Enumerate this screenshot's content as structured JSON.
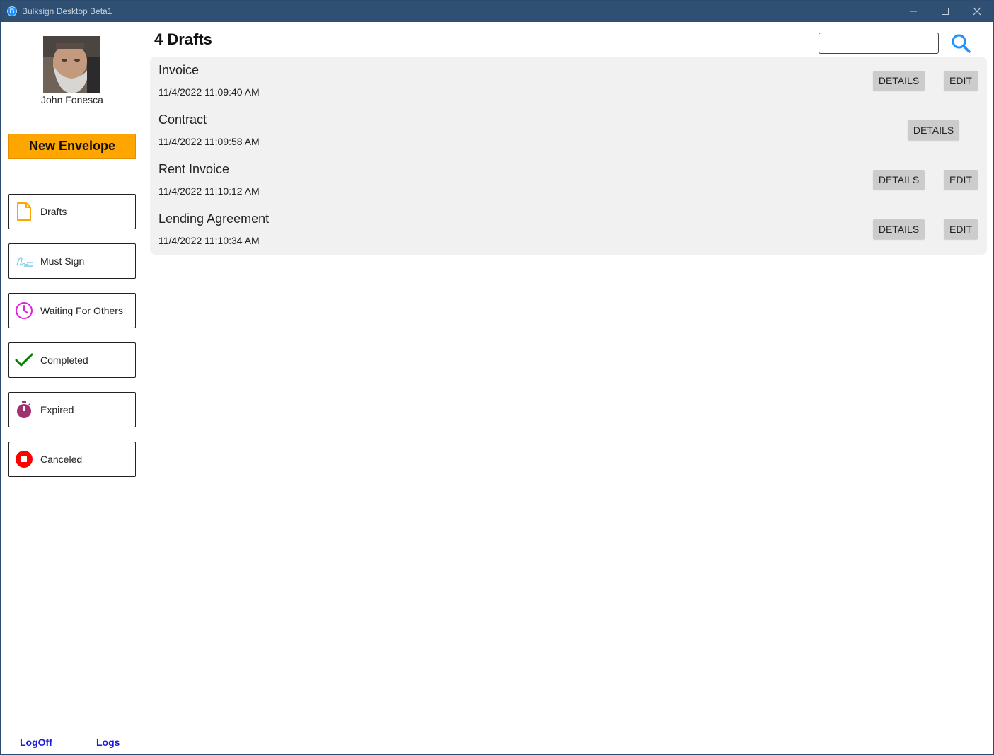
{
  "window": {
    "app_icon_letter": "B",
    "title": "Bulksign Desktop Beta1"
  },
  "sidebar": {
    "user_name": "John Fonesca",
    "new_envelope_label": "New Envelope",
    "items": [
      {
        "label": "Drafts",
        "icon": "document-icon",
        "color": "#FFA500"
      },
      {
        "label": "Must Sign",
        "icon": "signature-icon",
        "color": "#87CEEB"
      },
      {
        "label": "Waiting For Others",
        "icon": "clock-icon",
        "color": "#E020E0"
      },
      {
        "label": "Completed",
        "icon": "checkmark-icon",
        "color": "#008000"
      },
      {
        "label": "Expired",
        "icon": "stopwatch-icon",
        "color": "#A0306E"
      },
      {
        "label": "Canceled",
        "icon": "stop-icon",
        "color": "#FF0000"
      }
    ],
    "footer": {
      "logoff_label": "LogOff",
      "logs_label": "Logs"
    }
  },
  "main": {
    "title": "4 Drafts",
    "search": {
      "value": "",
      "placeholder": ""
    },
    "details_label": "DETAILS",
    "edit_label": "EDIT",
    "drafts": [
      {
        "name": "Invoice",
        "date": "11/4/2022 11:09:40 AM",
        "editable": true
      },
      {
        "name": "Contract",
        "date": "11/4/2022 11:09:58 AM",
        "editable": false
      },
      {
        "name": "Rent Invoice",
        "date": "11/4/2022 11:10:12 AM",
        "editable": true
      },
      {
        "name": "Lending Agreement",
        "date": "11/4/2022 11:10:34 AM",
        "editable": true
      }
    ]
  },
  "colors": {
    "titlebar": "#2F4F73",
    "accent_button": "#FFA500",
    "link": "#1A1ADF",
    "search_icon": "#1E90FF",
    "list_background": "#F1F1F1"
  }
}
